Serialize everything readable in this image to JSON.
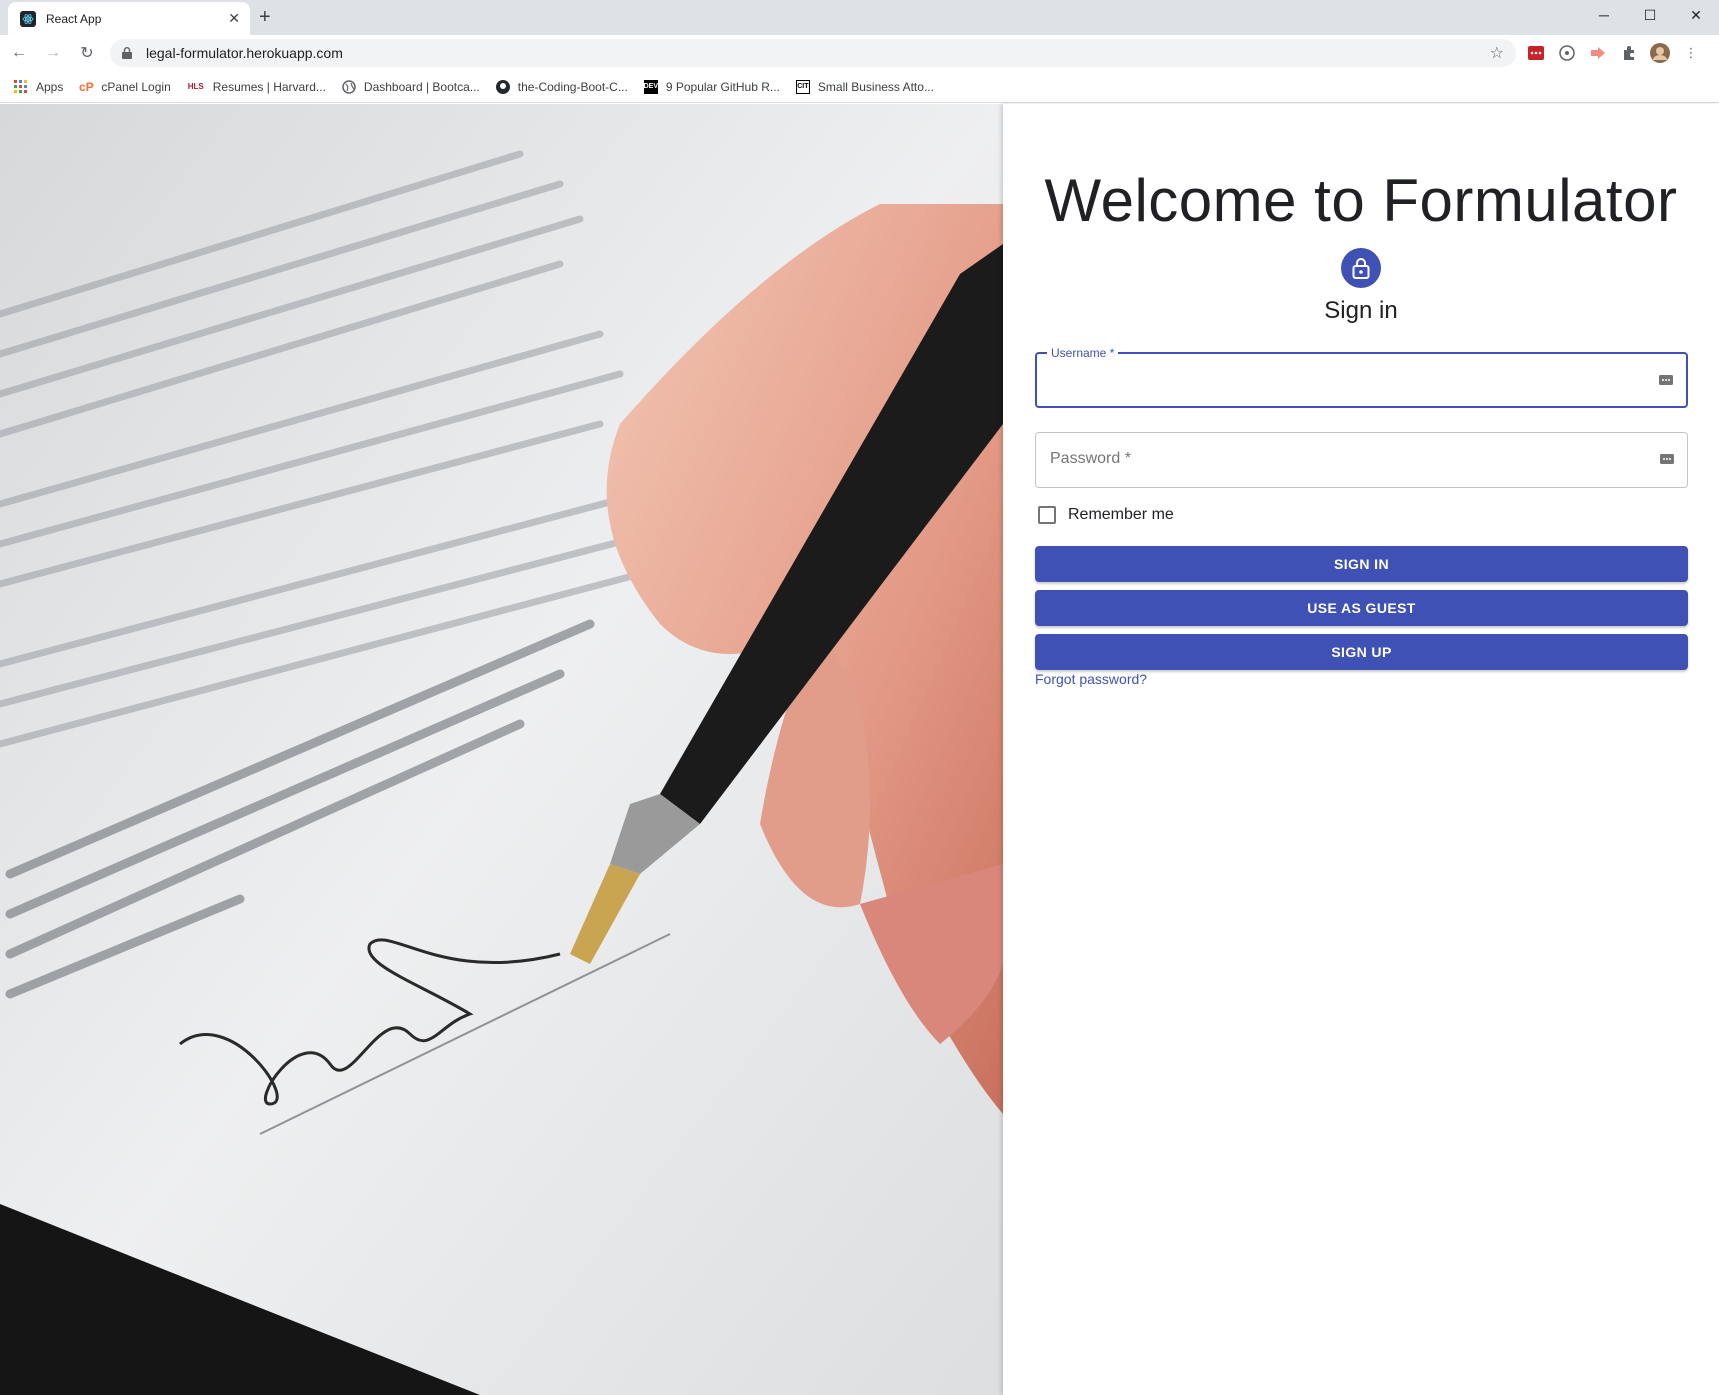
{
  "browser": {
    "tab_title": "React App",
    "url": "legal-formulator.herokuapp.com",
    "bookmarks": [
      {
        "label": "Apps",
        "icon": "apps-grid-icon"
      },
      {
        "label": "cPanel Login",
        "icon": "cpanel-icon"
      },
      {
        "label": "Resumes | Harvard...",
        "icon": "hls-icon"
      },
      {
        "label": "Dashboard | Bootca...",
        "icon": "globe-icon"
      },
      {
        "label": "the-Coding-Boot-C...",
        "icon": "github-icon"
      },
      {
        "label": "9 Popular GitHub R...",
        "icon": "dev-icon"
      },
      {
        "label": "Small Business Atto...",
        "icon": "cit-icon"
      }
    ],
    "bookmark_icon_text": {
      "hls": "HLS",
      "dev": "DEV",
      "cit": "CIT"
    }
  },
  "page": {
    "welcome": "Welcome to Formulator",
    "signin_title": "Sign in",
    "username_label": "Username *",
    "password_placeholder": "Password *",
    "remember_label": "Remember me",
    "signin_button": "SIGN IN",
    "guest_button": "USE AS GUEST",
    "signup_button": "SIGN UP",
    "forgot_link": "Forgot password?"
  },
  "photo_text": {
    "signature_line_label": "Signature"
  },
  "colors": {
    "primary": "#3f51b5",
    "tab_bar": "#dee1e6"
  }
}
